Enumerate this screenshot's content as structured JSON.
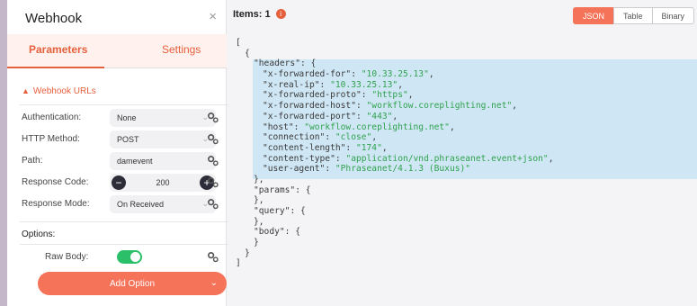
{
  "node": {
    "title": "Webhook",
    "close_glyph": "×"
  },
  "tabs": [
    {
      "label": "Parameters"
    },
    {
      "label": "Settings"
    }
  ],
  "section": {
    "label": "Webhook URLs"
  },
  "params": {
    "authentication": {
      "label": "Authentication:",
      "value": "None"
    },
    "http_method": {
      "label": "HTTP Method:",
      "value": "POST"
    },
    "path": {
      "label": "Path:",
      "value": "damevent"
    },
    "response_code": {
      "label": "Response Code:",
      "value": "200"
    },
    "response_mode": {
      "label": "Response Mode:",
      "value": "On Received"
    }
  },
  "options": {
    "label": "Options:",
    "raw_body_label": "Raw Body:",
    "raw_body_on": true
  },
  "add_option": {
    "label": "Add Option"
  },
  "output": {
    "items_label": "Items:",
    "items_count": "1",
    "views": [
      "JSON",
      "Table",
      "Binary"
    ],
    "active_view": "JSON"
  },
  "json_lines": [
    {
      "key": "",
      "val": "",
      "p": "["
    },
    {
      "key": "",
      "val": "",
      "p": "{"
    },
    {
      "key": "\"headers\"",
      "val": "",
      "p": ": {"
    },
    {
      "key": "\"x-forwarded-for\"",
      "val": "\"10.33.25.13\"",
      "p": ","
    },
    {
      "key": "\"x-real-ip\"",
      "val": "\"10.33.25.13\"",
      "p": ","
    },
    {
      "key": "\"x-forwarded-proto\"",
      "val": "\"https\"",
      "p": ","
    },
    {
      "key": "\"x-forwarded-host\"",
      "val": "\"workflow.coreplighting.net\"",
      "p": ","
    },
    {
      "key": "\"x-forwarded-port\"",
      "val": "\"443\"",
      "p": ","
    },
    {
      "key": "\"host\"",
      "val": "\"workflow.coreplighting.net\"",
      "p": ","
    },
    {
      "key": "\"connection\"",
      "val": "\"close\"",
      "p": ","
    },
    {
      "key": "\"content-length\"",
      "val": "\"174\"",
      "p": ","
    },
    {
      "key": "\"content-type\"",
      "val": "\"application/vnd.phraseanet.event+json\"",
      "p": ","
    },
    {
      "key": "\"user-agent\"",
      "val": "\"Phraseanet/4.1.3 (Buxus)\"",
      "p": ""
    },
    {
      "key": "",
      "val": "",
      "p": "},"
    },
    {
      "key": "\"params\"",
      "val": "",
      "p": ": {"
    },
    {
      "key": "",
      "val": "",
      "p": "},"
    },
    {
      "key": "\"query\"",
      "val": "",
      "p": ": {"
    },
    {
      "key": "",
      "val": "",
      "p": "},"
    },
    {
      "key": "\"body\"",
      "val": "",
      "p": ": {"
    },
    {
      "key": "",
      "val": "",
      "p": "}"
    },
    {
      "key": "",
      "val": "",
      "p": "}"
    },
    {
      "key": "",
      "val": "",
      "p": "]"
    }
  ],
  "colors": {
    "accent": "#e5603d",
    "button": "#f57359",
    "toggle_on": "#2cbf69",
    "json_string": "#30a14e",
    "highlight": "#cfe7f5"
  }
}
